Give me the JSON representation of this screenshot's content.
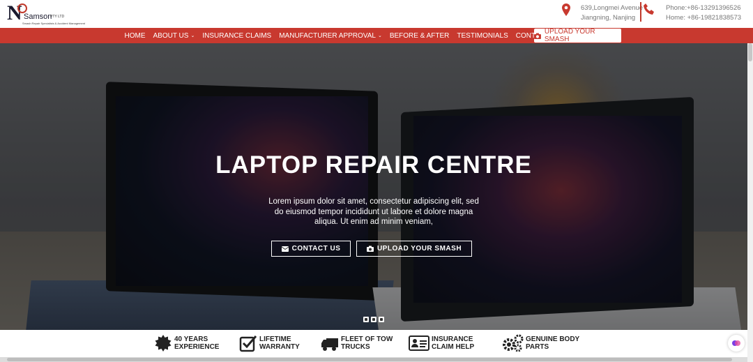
{
  "logo": {
    "letter": "N",
    "brand": "Samson",
    "brand_suffix": "PTY LTD",
    "tagline": "Smash Repair Specialists & Accident Management"
  },
  "contact": {
    "address_line1": "639,Longmei Avenue",
    "address_line2": "Jiangning, Nanjing",
    "phone_line1": "Phone:+86-13291396526",
    "phone_line2": "Home: +86-19821838573"
  },
  "nav": {
    "items": [
      {
        "label": "HOME",
        "caret": ""
      },
      {
        "label": "ABOUT US",
        "caret": "⌄"
      },
      {
        "label": "INSURANCE CLAIMS",
        "caret": ""
      },
      {
        "label": "MANUFACTURER APPROVAL",
        "caret": "⌄"
      },
      {
        "label": "BEFORE & AFTER",
        "caret": ""
      },
      {
        "label": "TESTIMONIALS",
        "caret": ""
      },
      {
        "label": "CONTACT US",
        "caret": ""
      }
    ],
    "upload_label": "UPLOAD YOUR SMASH"
  },
  "hero": {
    "title": "LAPTOP REPAIR CENTRE",
    "text": "Lorem ipsum dolor sit amet, consectetur adipiscing elit, sed do eiusmod tempor incididunt ut labore et dolore magna aliqua. Ut enim ad minim veniam,",
    "contact_button": "CONTACT US",
    "upload_button": "UPLOAD YOUR SMASH"
  },
  "features": [
    {
      "line1": "40 YEARS",
      "line2": "EXPERIENCE",
      "icon": "gear-badge-icon"
    },
    {
      "line1": "LIFETIME",
      "line2": "WARRANTY",
      "icon": "checkbox-icon"
    },
    {
      "line1": "FLEET OF TOW",
      "line2": "TRUCKS",
      "icon": "truck-icon"
    },
    {
      "line1": "INSURANCE",
      "line2": "CLAIM HELP",
      "icon": "id-card-icon"
    },
    {
      "line1": "GENUINE BODY",
      "line2": "PARTS",
      "icon": "gears-icon"
    }
  ],
  "colors": {
    "accent": "#c8392f",
    "text_dark": "#222222",
    "muted": "#777777"
  }
}
